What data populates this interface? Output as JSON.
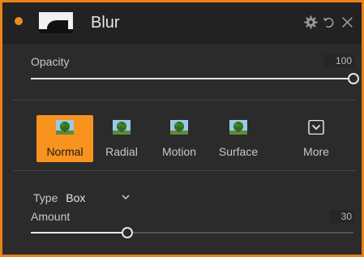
{
  "panel": {
    "title": "Blur",
    "status_color": "#f08a1c",
    "accent_color": "#f7931e",
    "header_icons": [
      "gear-icon",
      "reset-icon",
      "close-icon"
    ]
  },
  "opacity": {
    "label": "Opacity",
    "value": "100",
    "level": 1.0
  },
  "modes": [
    {
      "label": "Normal",
      "icon": "tree-thumbnail-icon",
      "selected": true
    },
    {
      "label": "Radial",
      "icon": "tree-thumbnail-icon",
      "selected": false
    },
    {
      "label": "Motion",
      "icon": "tree-thumbnail-icon",
      "selected": false
    },
    {
      "label": "Surface",
      "icon": "tree-thumbnail-icon",
      "selected": false
    },
    {
      "label": "More",
      "icon": "chevron-down-box-icon",
      "selected": false
    }
  ],
  "type": {
    "label": "Type",
    "value": "Box"
  },
  "amount": {
    "label": "Amount",
    "value": "30",
    "level": 0.3
  }
}
